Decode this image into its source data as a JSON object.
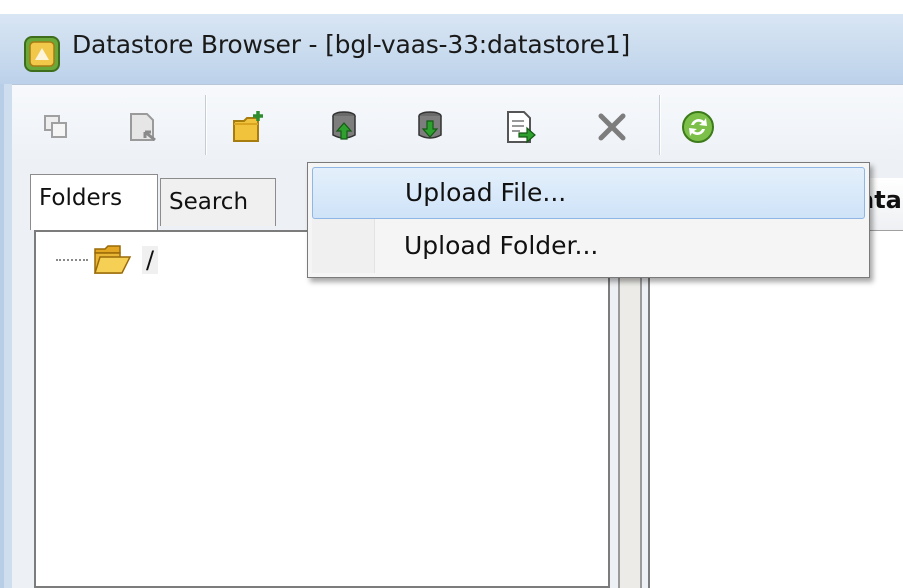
{
  "window": {
    "title": "Datastore Browser - [bgl-vaas-33:datastore1]",
    "app_icon": "datastore-app-icon"
  },
  "toolbar": {
    "buttons": [
      {
        "name": "copy-icon",
        "enabled": false
      },
      {
        "name": "move-icon",
        "enabled": false
      },
      {
        "name": "new-folder-icon",
        "enabled": true
      },
      {
        "name": "upload-icon",
        "enabled": true
      },
      {
        "name": "download-icon",
        "enabled": true
      },
      {
        "name": "register-vm-icon",
        "enabled": true
      },
      {
        "name": "delete-icon",
        "enabled": true
      },
      {
        "name": "refresh-icon",
        "enabled": true
      }
    ]
  },
  "tabs": {
    "folders": "Folders",
    "search": "Search",
    "active": "Folders"
  },
  "tree": {
    "root_label": "/"
  },
  "right_panel": {
    "header_fragment": "ata"
  },
  "menu": {
    "items": [
      {
        "label": "Upload File...",
        "highlighted": true
      },
      {
        "label": "Upload Folder...",
        "highlighted": false
      }
    ]
  },
  "colors": {
    "titlebar": "#c9dbee",
    "menu_highlight": "#cfe3f8",
    "menu_highlight_border": "#8fb6e4"
  }
}
